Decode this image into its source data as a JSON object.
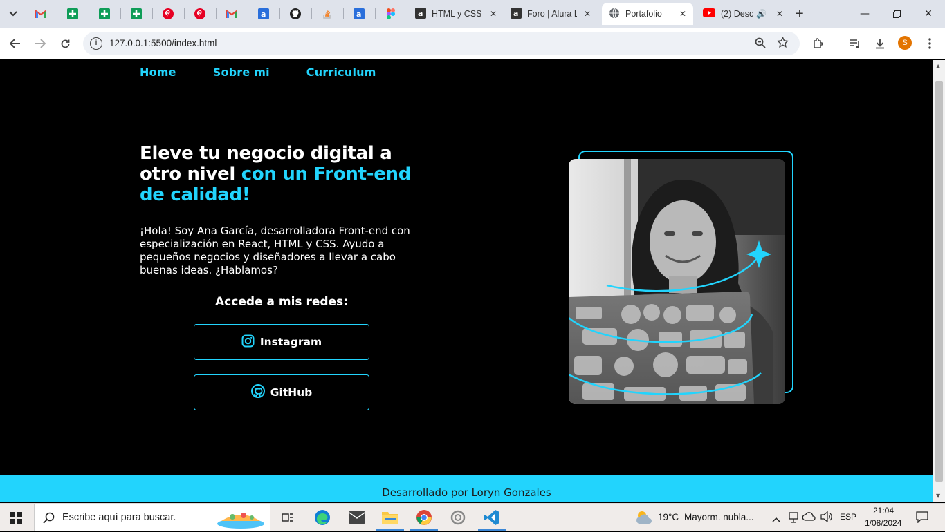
{
  "browser": {
    "tabs": [
      {
        "title": "HTML y CSS:",
        "icon": "alura-icon"
      },
      {
        "title": "Foro | Alura L",
        "icon": "alura-icon"
      },
      {
        "title": "Portafolio",
        "icon": "globe-icon",
        "active": true
      },
      {
        "title": "(2) Desc",
        "icon": "youtube-icon"
      }
    ],
    "url": "127.0.0.1:5500/index.html",
    "profile_initial": "S"
  },
  "page": {
    "nav": [
      "Home",
      "Sobre mi",
      "Curriculum"
    ],
    "hero": {
      "title_white": "Eleve tu negocio digital a otro nivel ",
      "title_accent": "con un Front-end de calidad!",
      "text": "¡Hola! Soy Ana García, desarrolladora Front-end con especialización en React, HTML y CSS. Ayudo a pequeños negocios y diseñadores a llevar a cabo buenas ideas. ¿Hablamos?"
    },
    "social": {
      "heading": "Accede a mis redes:",
      "instagram_label": "Instagram",
      "github_label": "GitHub"
    },
    "footer": "Desarrollado por Loryn Gonzales"
  },
  "taskbar": {
    "search_placeholder": "Escribe aquí para buscar.",
    "temperature": "19°C",
    "weather": "Mayorm. nubla...",
    "language": "ESP",
    "time": "21:04",
    "date": "1/08/2024"
  },
  "colors": {
    "accent": "#22d4fd",
    "background": "#000000"
  }
}
